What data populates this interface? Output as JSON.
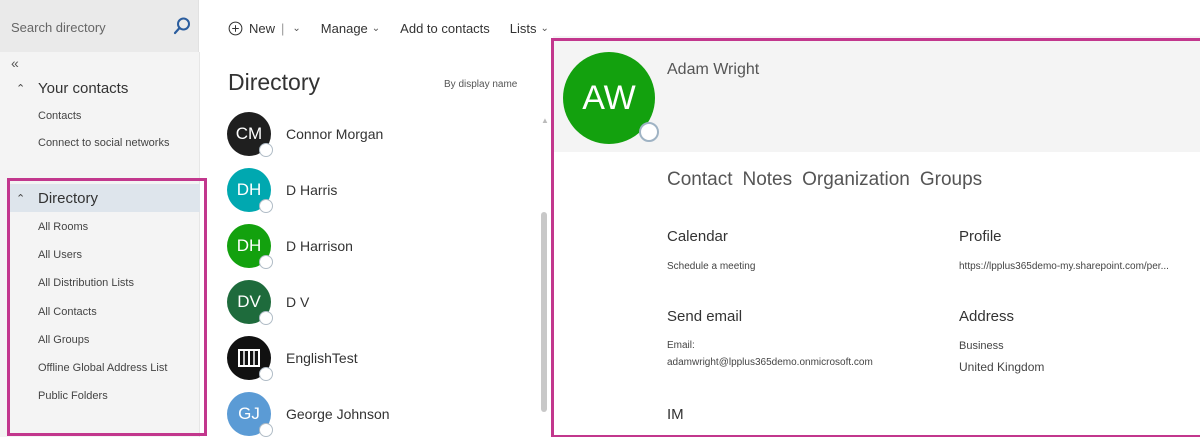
{
  "search": {
    "placeholder": "Search directory"
  },
  "toolbar": {
    "new_label": "New",
    "manage_label": "Manage",
    "add_label": "Add to contacts",
    "lists_label": "Lists"
  },
  "leftnav": {
    "collapse": "«",
    "your_contacts": {
      "label": "Your contacts",
      "items": [
        "Contacts",
        "Connect to social networks"
      ]
    },
    "directory": {
      "label": "Directory",
      "items": [
        "All Rooms",
        "All Users",
        "All Distribution Lists",
        "All Contacts",
        "All Groups",
        "Offline Global Address List",
        "Public Folders"
      ]
    }
  },
  "list": {
    "title": "Directory",
    "sort": "By display name",
    "contacts": [
      {
        "initials": "CM",
        "name": "Connor Morgan",
        "color": "#1f1f1f"
      },
      {
        "initials": "DH",
        "name": "D Harris",
        "color": "#00a8b0"
      },
      {
        "initials": "DH",
        "name": "D Harrison",
        "color": "#13a10e"
      },
      {
        "initials": "DV",
        "name": "D V",
        "color": "#1e6b3c"
      },
      {
        "initials": "",
        "name": "EnglishTest",
        "color": "#111111"
      },
      {
        "initials": "GJ",
        "name": "George Johnson",
        "color": "#5b9bd5"
      }
    ]
  },
  "detail": {
    "initials": "AW",
    "name": "Adam Wright",
    "tabs": [
      "Contact",
      "Notes",
      "Organization",
      "Groups"
    ],
    "calendar": {
      "title": "Calendar",
      "link": "Schedule a meeting"
    },
    "profile": {
      "title": "Profile",
      "url": "https://lpplus365demo-my.sharepoint.com/per..."
    },
    "email": {
      "title": "Send email",
      "label": "Email:",
      "value": "adamwright@lpplus365demo.onmicrosoft.com"
    },
    "address": {
      "title": "Address",
      "type": "Business",
      "country": "United Kingdom"
    },
    "im": {
      "title": "IM"
    }
  }
}
